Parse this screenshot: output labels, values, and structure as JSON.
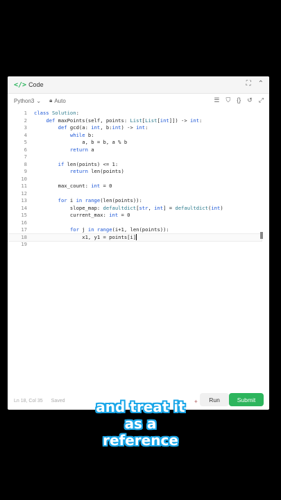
{
  "titlebar": {
    "code_icon": "</>",
    "title": "Code",
    "icons": [
      "expand-icon",
      "chevron-up-icon"
    ]
  },
  "toolbar": {
    "language": "Python3",
    "mode": "Auto",
    "icons": [
      "format-icon",
      "bookmark-icon",
      "braces-icon",
      "undo-icon",
      "fullscreen-icon"
    ]
  },
  "editor": {
    "lines": [
      {
        "n": "1",
        "text": "class Solution:"
      },
      {
        "n": "2",
        "text": "    def maxPoints(self, points: List[List[int]]) -> int:"
      },
      {
        "n": "3",
        "text": "        def gcd(a: int, b:int) -> int:"
      },
      {
        "n": "4",
        "text": "            while b:"
      },
      {
        "n": "5",
        "text": "                a, b = b, a % b"
      },
      {
        "n": "6",
        "text": "            return a"
      },
      {
        "n": "7",
        "text": ""
      },
      {
        "n": "8",
        "text": "        if len(points) <= 1:"
      },
      {
        "n": "9",
        "text": "            return len(points)"
      },
      {
        "n": "10",
        "text": ""
      },
      {
        "n": "11",
        "text": "        max_count: int = 0"
      },
      {
        "n": "12",
        "text": ""
      },
      {
        "n": "13",
        "text": "        for i in range(len(points)):"
      },
      {
        "n": "14",
        "text": "            slope_map: defaultdict[str, int] = defaultdict(int)"
      },
      {
        "n": "15",
        "text": "            current_max: int = 0"
      },
      {
        "n": "16",
        "text": ""
      },
      {
        "n": "17",
        "text": "            for j in range(i+1, len(points)):"
      },
      {
        "n": "18",
        "text": "                x1, y1 = points[i]"
      },
      {
        "n": "19",
        "text": ""
      }
    ],
    "active_line": 18
  },
  "footer": {
    "status": "Ln 18, Col 35",
    "saved": "Saved",
    "run_label": "Run",
    "submit_label": "Submit"
  },
  "caption": {
    "line1": "and treat it",
    "line2": "as a",
    "line3": "reference"
  },
  "colors": {
    "accent": "#2db55d",
    "caption_outline": "#1aa6e8",
    "keyword": "#1a55d6"
  }
}
